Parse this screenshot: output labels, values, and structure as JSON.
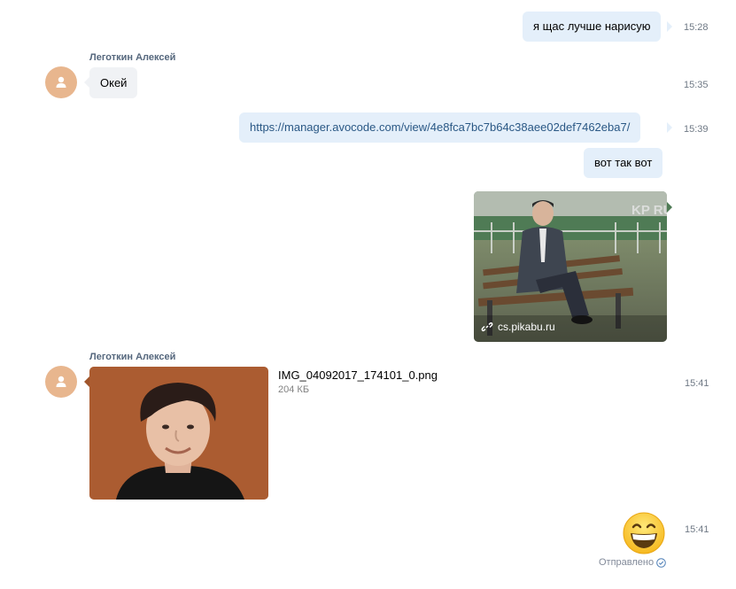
{
  "messages": [
    {
      "text": "я щас лучше нарисую",
      "time": "15:28"
    },
    {
      "author": "Леготкин Алексей",
      "text": "Окей",
      "time": "15:35"
    },
    {
      "text": "https://manager.avocode.com/view/4e8fca7bc7b64c38aee02def7462eba7/",
      "time": "15:39"
    },
    {
      "text": "вот так вот"
    },
    {
      "source": "cs.pikabu.ru",
      "watermark": "KP RU"
    },
    {
      "author": "Леготкин Алексей",
      "file_name": "IMG_04092017_174101_0.png",
      "file_size": "204 КБ",
      "time": "15:41"
    },
    {
      "time": "15:41",
      "status": "Отправлено"
    }
  ],
  "colors": {
    "outgoing_bubble": "#e4effa",
    "incoming_bubble": "#f0f2f5",
    "link": "#2a5885",
    "author": "#55677d",
    "avatar": "#e8b68e"
  },
  "icons": [
    "user-avatar-icon",
    "link-icon",
    "smile-emoji-icon",
    "check-circle-icon"
  ]
}
